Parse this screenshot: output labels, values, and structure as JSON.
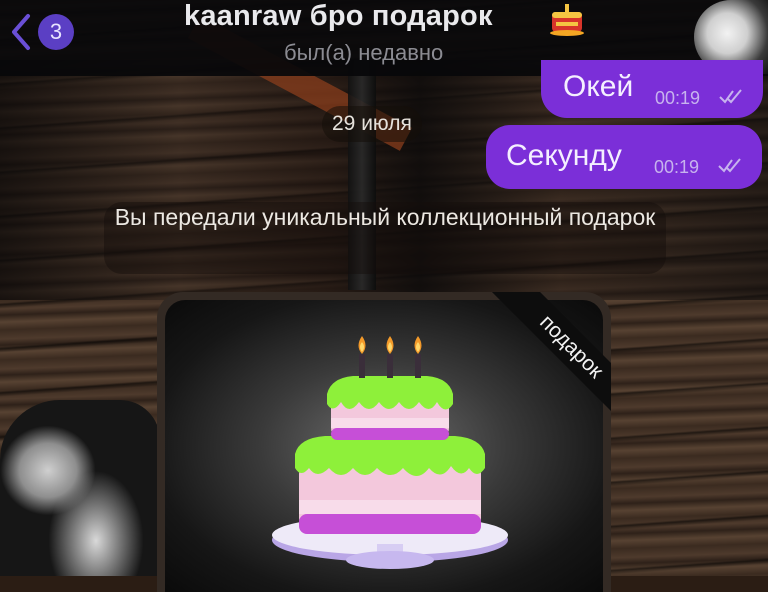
{
  "header": {
    "back_badge_count": "3",
    "title": "kaanraw бро подарок",
    "title_emoji": "birthday-cake-emoji",
    "status": "был(а) недавно",
    "accent_color": "#5b3fc4"
  },
  "messages": [
    {
      "text": "Окей",
      "time": "00:19",
      "read": true,
      "outgoing": true
    },
    {
      "text": "Секунду",
      "time": "00:19",
      "read": true,
      "outgoing": true
    }
  ],
  "date_separator": "29 июля",
  "service_message": "Вы передали уникальный коллекционный подарок",
  "gift": {
    "ribbon_label": "подарок",
    "icon": "birthday-cake-icon",
    "colors": {
      "icing": "#8ef03a",
      "cake": "#f3c8dc",
      "plate": "#e9e4f7",
      "bubble": "#7b2fd8"
    }
  }
}
